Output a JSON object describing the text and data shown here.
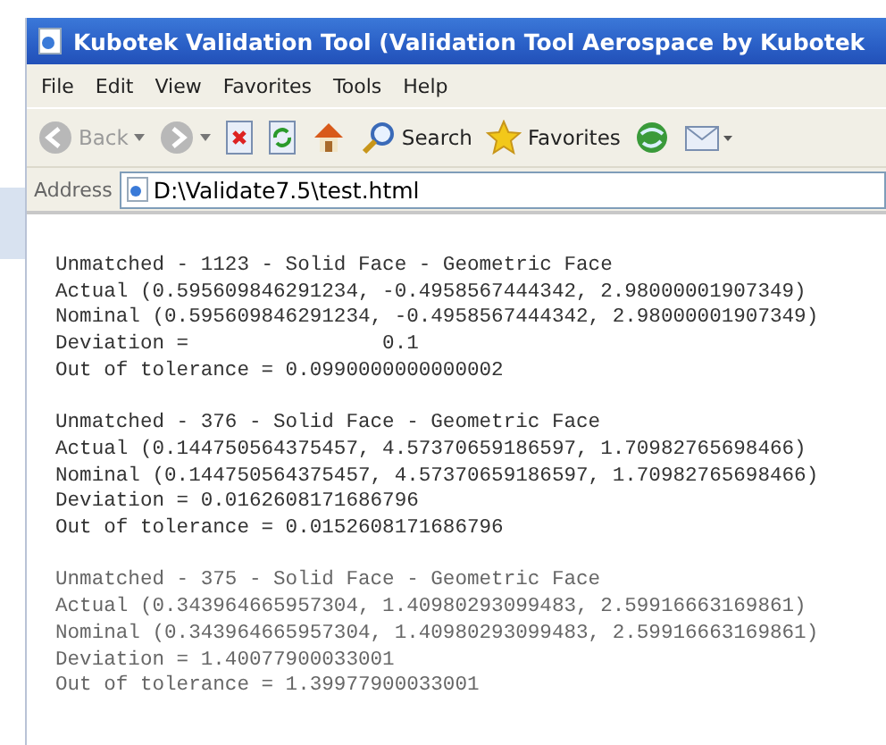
{
  "window": {
    "title": "Kubotek Validation Tool (Validation Tool Aerospace by Kubotek"
  },
  "menu": [
    "File",
    "Edit",
    "View",
    "Favorites",
    "Tools",
    "Help"
  ],
  "toolbar": [
    {
      "kind": "back",
      "label": "Back",
      "disabled": true
    },
    {
      "kind": "forward",
      "disabled": true
    },
    {
      "kind": "stop"
    },
    {
      "kind": "refresh"
    },
    {
      "kind": "home"
    },
    {
      "kind": "search",
      "label": "Search"
    },
    {
      "kind": "favorites",
      "label": "Favorites"
    },
    {
      "kind": "media"
    },
    {
      "kind": "mail"
    }
  ],
  "address": {
    "label": "Address",
    "value": "D:\\Validate7.5\\test.html"
  },
  "report": [
    {
      "heading": "Unmatched - 1123 - Solid Face - Geometric Face",
      "lines": [
        "Actual (0.595609846291234, -0.4958567444342, 2.98000001907349)",
        "Nominal (0.595609846291234, -0.4958567444342, 2.98000001907349)",
        "Deviation =                0.1",
        "Out of tolerance = 0.0990000000000002"
      ]
    },
    {
      "heading": "Unmatched - 376 - Solid Face - Geometric Face",
      "lines": [
        "Actual (0.144750564375457, 4.57370659186597, 1.70982765698466)",
        "Nominal (0.144750564375457, 4.57370659186597, 1.70982765698466)",
        "Deviation = 0.0162608171686796",
        "Out of tolerance = 0.0152608171686796"
      ]
    },
    {
      "heading": "Unmatched - 375 - Solid Face - Geometric Face",
      "lines": [
        "Actual (0.343964665957304, 1.40980293099483, 2.59916663169861)",
        "Nominal (0.343964665957304, 1.40980293099483, 2.59916663169861)",
        "Deviation = 1.40077900033001",
        "Out of tolerance = 1.39977900033001"
      ]
    }
  ]
}
